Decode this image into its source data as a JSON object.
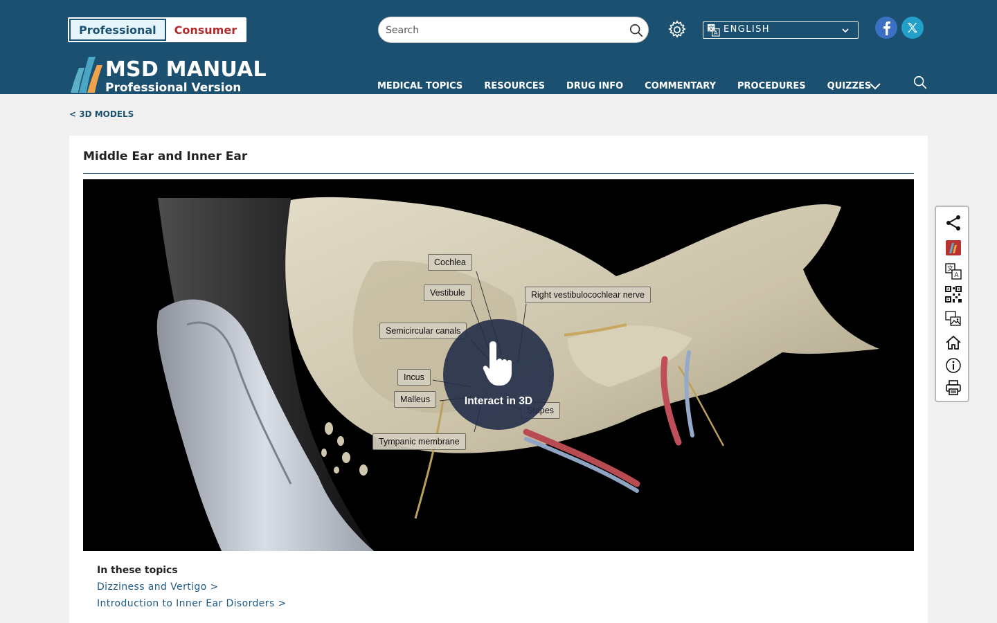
{
  "header": {
    "audience": {
      "professional": "Professional",
      "consumer": "Consumer"
    },
    "search": {
      "placeholder": "Search"
    },
    "language": {
      "selected": "ENGLISH"
    },
    "brand": {
      "title": "MSD MANUAL",
      "subtitle": "Professional Version"
    },
    "nav": [
      "MEDICAL TOPICS",
      "RESOURCES",
      "DRUG INFO",
      "COMMENTARY",
      "PROCEDURES",
      "QUIZZES"
    ]
  },
  "breadcrumb": "<  3D MODELS",
  "page": {
    "title": "Middle Ear and Inner Ear",
    "labels": {
      "cochlea": "Cochlea",
      "vestibule": "Vestibule",
      "nerve": "Right vestibulocochlear nerve",
      "semicircular": "Semicircular canals",
      "incus": "Incus",
      "malleus": "Malleus",
      "stapes": "Stapes",
      "tympanic": "Tympanic membrane"
    },
    "interact": "Interact in 3D"
  },
  "topics": {
    "heading": "In these topics",
    "links": [
      "Dizziness and Vertigo >",
      "Introduction to Inner Ear Disorders >"
    ]
  },
  "colors": {
    "header_bg": "#1b5070",
    "consumer_red": "#b12a2a",
    "link_blue": "#1e5a86",
    "bone": "#d4ccb6"
  },
  "icons": [
    "search-icon",
    "gear-icon",
    "translate-icon",
    "chevron-down-icon",
    "facebook-icon",
    "x-twitter-icon",
    "share-icon",
    "msd-logo-icon",
    "qr-code-icon",
    "image-gallery-icon",
    "home-icon",
    "info-icon",
    "print-icon",
    "hand-pointer-icon"
  ]
}
